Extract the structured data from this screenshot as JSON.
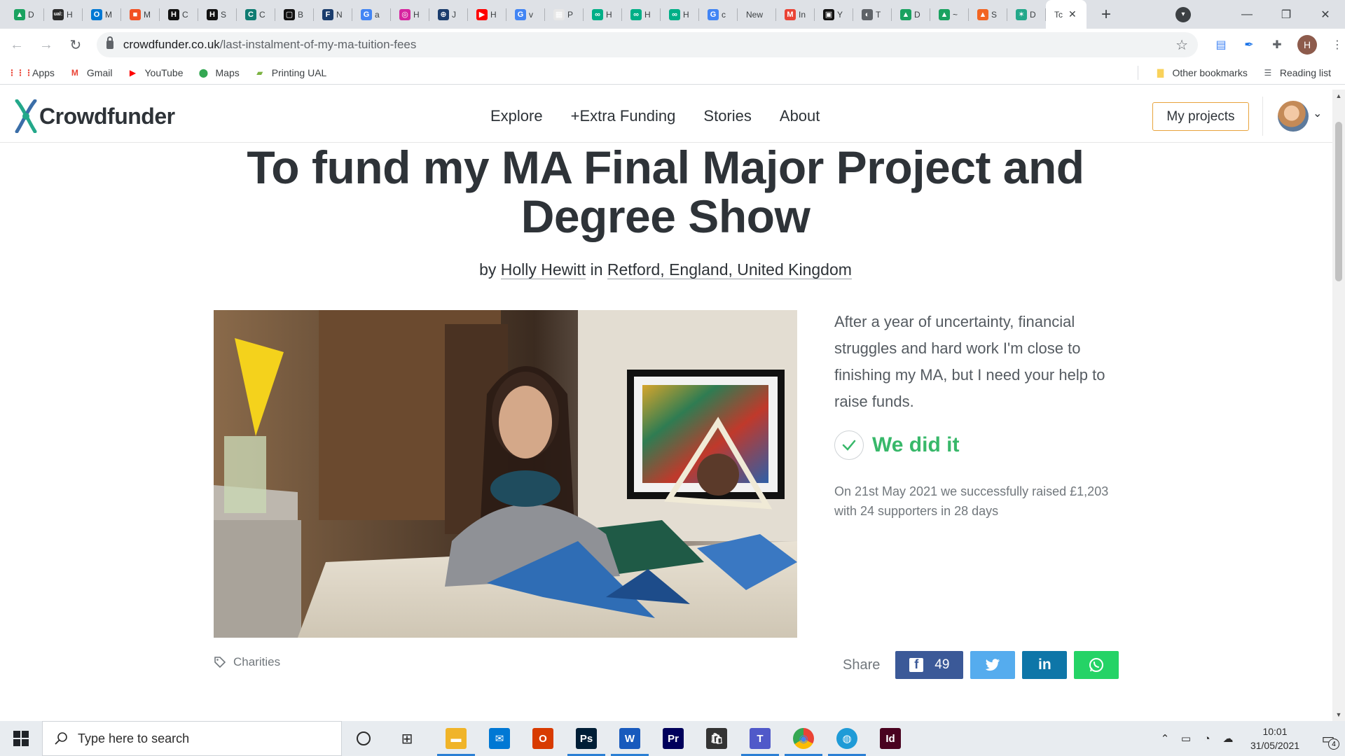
{
  "browser": {
    "tabs": [
      {
        "title": "D",
        "fav_color": "#1aa260",
        "glyph": "▲"
      },
      {
        "title": "H",
        "fav_color": "#2b2b2b",
        "glyph": "ual:"
      },
      {
        "title": "M",
        "fav_color": "#0078d4",
        "glyph": "O"
      },
      {
        "title": "M",
        "fav_color": "#f25022",
        "glyph": "■"
      },
      {
        "title": "C",
        "fav_color": "#111111",
        "glyph": "H"
      },
      {
        "title": "S",
        "fav_color": "#111111",
        "glyph": "H"
      },
      {
        "title": "C",
        "fav_color": "#0f7c72",
        "glyph": "C"
      },
      {
        "title": "B",
        "fav_color": "#111111",
        "glyph": "▢"
      },
      {
        "title": "N",
        "fav_color": "#1b3d6d",
        "glyph": "F"
      },
      {
        "title": "a",
        "fav_color": "#4285f4",
        "glyph": "G"
      },
      {
        "title": "H",
        "fav_color": "#d6249f",
        "glyph": "◎"
      },
      {
        "title": "J",
        "fav_color": "#1b3d6d",
        "glyph": "⊕"
      },
      {
        "title": "H",
        "fav_color": "#ff0000",
        "glyph": "▶"
      },
      {
        "title": "v",
        "fav_color": "#4285f4",
        "glyph": "G"
      },
      {
        "title": "P",
        "fav_color": "#e7e7e7",
        "glyph": "▦"
      },
      {
        "title": "H",
        "fav_color": "#00af87",
        "glyph": "∞"
      },
      {
        "title": "H",
        "fav_color": "#00af87",
        "glyph": "∞"
      },
      {
        "title": "H",
        "fav_color": "#00af87",
        "glyph": "∞"
      },
      {
        "title": "c",
        "fav_color": "#4285f4",
        "glyph": "G"
      },
      {
        "title": "New",
        "fav_color": "",
        "glyph": ""
      },
      {
        "title": "In",
        "fav_color": "#ea4335",
        "glyph": "M"
      },
      {
        "title": "Y",
        "fav_color": "#111111",
        "glyph": "▣"
      },
      {
        "title": "T",
        "fav_color": "#5f6368",
        "glyph": "◐"
      },
      {
        "title": "D",
        "fav_color": "#1aa260",
        "glyph": "▲"
      },
      {
        "title": "~",
        "fav_color": "#1aa260",
        "glyph": "▲"
      },
      {
        "title": "S",
        "fav_color": "#f26522",
        "glyph": "▲"
      },
      {
        "title": "D",
        "fav_color": "#23a88a",
        "glyph": "✶"
      }
    ],
    "active_tab": {
      "title": "Tc",
      "close": "✕"
    },
    "new_tab": "+",
    "url_host": "crowdfunder.co.uk",
    "url_path": "/last-instalment-of-my-ma-tuition-fees",
    "profile_initial": "H",
    "bookmarks": [
      {
        "label": "Apps",
        "color": "#ea4335",
        "glyph": "⋮⋮⋮"
      },
      {
        "label": "Gmail",
        "color": "#ea4335",
        "glyph": "M"
      },
      {
        "label": "YouTube",
        "color": "#ff0000",
        "glyph": "▶"
      },
      {
        "label": "Maps",
        "color": "#34a853",
        "glyph": "⬤"
      },
      {
        "label": "Printing UAL",
        "color": "#7cb342",
        "glyph": "▰"
      }
    ],
    "other_bookmarks": "Other bookmarks",
    "reading_list": "Reading list"
  },
  "site": {
    "logo_text": "Crowdfunder",
    "nav": [
      "Explore",
      "+Extra Funding",
      "Stories",
      "About"
    ],
    "my_projects": "My projects"
  },
  "project": {
    "title": "To fund my MA Final Major Project and Degree Show",
    "by": "by",
    "author": "Holly Hewitt",
    "in": "in",
    "location": "Retford, England, United Kingdom",
    "summary": "After a year of uncertainty, financial struggles and hard work I'm close to finishing my MA, but I need your help to raise funds.",
    "status": "We did it",
    "raised_text": "On 21st May 2021 we successfully raised £1,203 with 24 supporters in 28 days",
    "category": "Charities",
    "share_label": "Share",
    "facebook_count": "49",
    "colors": {
      "success": "#38b86a",
      "facebook": "#3b5998",
      "twitter": "#55acee",
      "linkedin": "#0e76a8",
      "whatsapp": "#25d366",
      "accent_button": "#e8a33c"
    }
  },
  "taskbar": {
    "search_placeholder": "Type here to search",
    "apps": [
      {
        "name": "file-explorer",
        "color": "#f0b429",
        "glyph": "▬",
        "open": true
      },
      {
        "name": "mail",
        "color": "#0078d4",
        "glyph": "✉",
        "open": false
      },
      {
        "name": "office",
        "color": "#d83b01",
        "glyph": "O",
        "open": false
      },
      {
        "name": "photoshop",
        "color": "#001e36",
        "glyph": "Ps",
        "open": true
      },
      {
        "name": "word",
        "color": "#185abd",
        "glyph": "W",
        "open": true
      },
      {
        "name": "premiere",
        "color": "#00005b",
        "glyph": "Pr",
        "open": false
      },
      {
        "name": "store",
        "color": "#333333",
        "glyph": "🛍",
        "open": false
      },
      {
        "name": "teams",
        "color": "#5059c9",
        "glyph": "T",
        "open": true
      },
      {
        "name": "chrome",
        "color": "#ffffff",
        "glyph": "◉",
        "open": true
      },
      {
        "name": "globe",
        "color": "#1f9bd7",
        "glyph": "◍",
        "open": true
      },
      {
        "name": "indesign",
        "color": "#49021f",
        "glyph": "Id",
        "open": false
      }
    ],
    "time": "10:01",
    "date": "31/05/2021",
    "notification_count": "4"
  }
}
